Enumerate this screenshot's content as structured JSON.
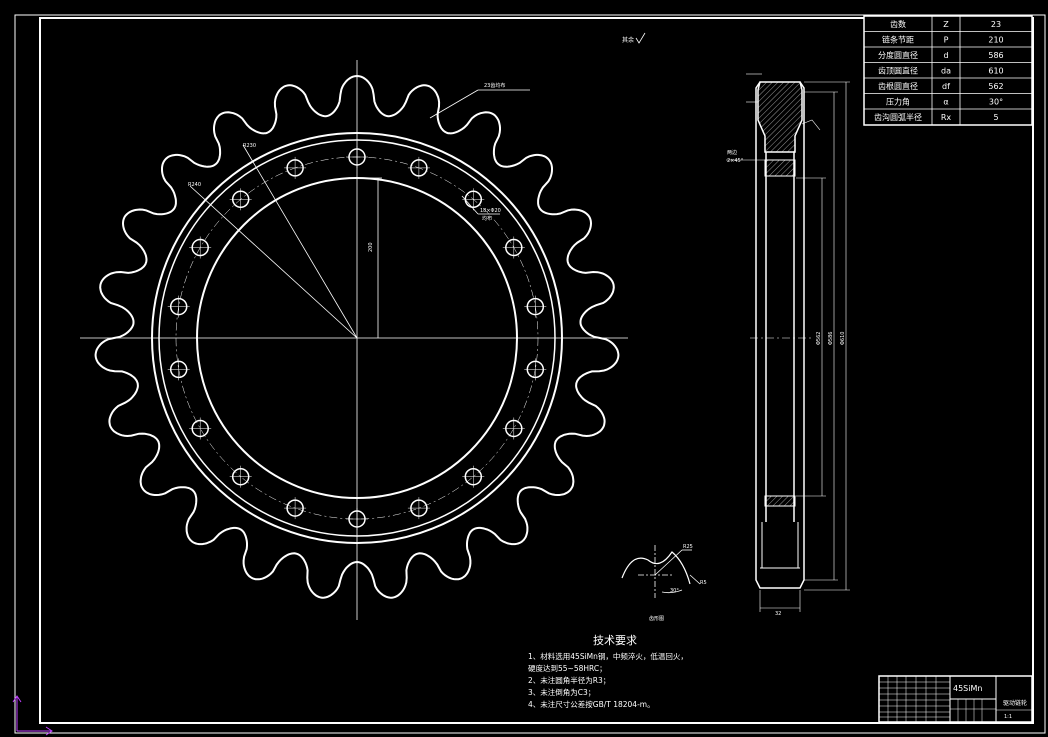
{
  "param_table": {
    "rows": [
      {
        "name": "齿数",
        "symbol": "Z",
        "value": "23"
      },
      {
        "name": "链条节距",
        "symbol": "P",
        "value": "210"
      },
      {
        "name": "分度圆直径",
        "symbol": "d",
        "value": "586"
      },
      {
        "name": "齿顶圆直径",
        "symbol": "da",
        "value": "610"
      },
      {
        "name": "齿根圆直径",
        "symbol": "df",
        "value": "562"
      },
      {
        "name": "压力角",
        "symbol": "α",
        "value": "30°"
      },
      {
        "name": "齿沟圆弧半径",
        "symbol": "Rx",
        "value": "5"
      }
    ]
  },
  "roughness_note": "其余",
  "annotations": {
    "teeth_label": "23齿均布",
    "holes_label": "18×Φ20",
    "holes_sub": "均布",
    "dim_vertical": "200",
    "dim_r230": "R230",
    "dim_r240": "R240",
    "chamfer_label": "两边",
    "chamfer_sub": "2×45°",
    "tooth_profile_caption": "齿形图",
    "dim_r25": "R25",
    "dim_r5": "R5",
    "dim_30": "30°",
    "side_dim_1": "Φ610",
    "side_dim_2": "Φ586",
    "side_dim_3": "Φ562",
    "width_dim": "32"
  },
  "tech_requirements": {
    "title": "技术要求",
    "lines": [
      "1、材料选用45SiMn钢，中频淬火，低温回火，",
      "硬度达到55~58HRC；",
      "2、未注圆角半径为R3；",
      "3、未注倒角为C3；",
      "4、未注尺寸公差按GB/T 18204-m。"
    ]
  },
  "title_block": {
    "material": "45SiMn",
    "part_name": "驱动链轮",
    "drawing_no": "1:1"
  }
}
